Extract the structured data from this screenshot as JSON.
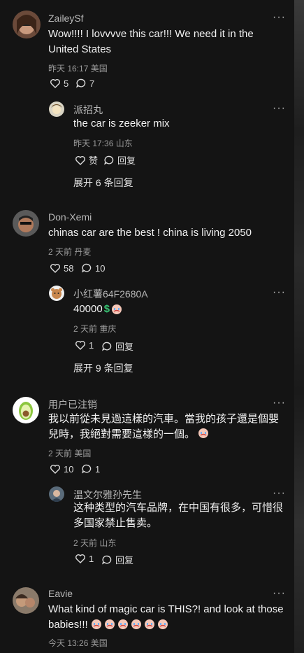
{
  "c1": {
    "name": "ZaileySf",
    "text": "Wow!!!! I lovvvve this car!!! We need it in the United States",
    "meta": "昨天 16:17 美国",
    "likes": "5",
    "replies": "7"
  },
  "r1": {
    "name": "派招丸",
    "text": "the car is zeeker mix",
    "meta": "昨天 17:36 山东",
    "likes": "赞",
    "replies": "回复"
  },
  "expand1": "展开 6 条回复",
  "c2": {
    "name": "Don-Xemi",
    "text": "chinas car are the best ! china is living 2050",
    "meta": "2 天前 丹麦",
    "likes": "58",
    "replies": "10"
  },
  "r2": {
    "name": "小红薯64F2680A",
    "text": "40000",
    "meta": "2 天前 重庆",
    "likes": "1",
    "replies": "回复"
  },
  "expand2": "展开 9 条回复",
  "c3": {
    "name": "用户已注销",
    "text": "我以前從未見過這樣的汽車。當我的孩子還是個嬰兒時，我絕對需要這樣的一個。",
    "meta": "2 天前 美国",
    "likes": "10",
    "replies": "1"
  },
  "r3": {
    "name": "温文尔雅孙先生",
    "text": "这种类型的汽车品牌，在中国有很多，可惜很多国家禁止售卖。",
    "meta": "2 天前 山东",
    "likes": "1",
    "replies": "回复"
  },
  "c4": {
    "name": "Eavie",
    "text": "What kind of magic car is THIS?! and look at those babies!!!",
    "meta": "今天 13:26 美国"
  },
  "more_glyph": "···",
  "colors": {
    "bg": "#141414",
    "muted": "#9a9a9a",
    "text": "#f2f2f2"
  }
}
